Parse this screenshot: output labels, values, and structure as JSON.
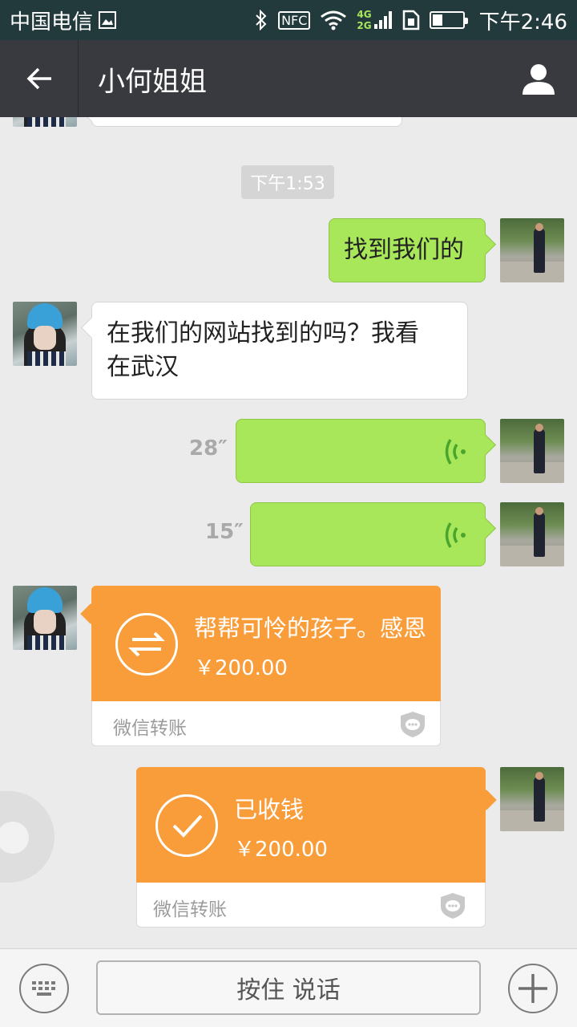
{
  "status_bar": {
    "carrier": "中国电信",
    "nfc": "NFC",
    "network_4g": "4G",
    "network_2g": "2G",
    "time": "下午2:46"
  },
  "header": {
    "title": "小何姐姐"
  },
  "chat": {
    "timestamp": "下午1:53",
    "messages": [
      {
        "side": "right",
        "type": "text",
        "text": "找到我们的"
      },
      {
        "side": "left",
        "type": "text",
        "line1": "在我们的网站找到的吗？我看",
        "line2": "在武汉"
      },
      {
        "side": "right",
        "type": "voice",
        "duration": "28″"
      },
      {
        "side": "right",
        "type": "voice",
        "duration": "15″"
      },
      {
        "side": "left",
        "type": "transfer",
        "title": "帮帮可怜的孩子。感恩",
        "amount": "￥200.00",
        "label": "微信转账"
      },
      {
        "side": "right",
        "type": "transfer",
        "title": "已收钱",
        "amount": "￥200.00",
        "label": "微信转账"
      }
    ]
  },
  "input_bar": {
    "hold_to_talk": "按住 说话"
  },
  "icons": {
    "back": "arrow-left-icon",
    "profile": "person-icon",
    "keyboard": "keyboard-icon",
    "plus": "plus-icon",
    "voice": "voice-wave-icon",
    "transfer": "transfer-arrows-icon",
    "received": "check-icon",
    "shield": "wechat-pay-shield-icon"
  },
  "colors": {
    "status_bar": "#233a3d",
    "title_bar": "#393a3f",
    "chat_bg": "#ebebeb",
    "my_bubble": "#a8e75a",
    "transfer_orange": "#f99d3a"
  }
}
